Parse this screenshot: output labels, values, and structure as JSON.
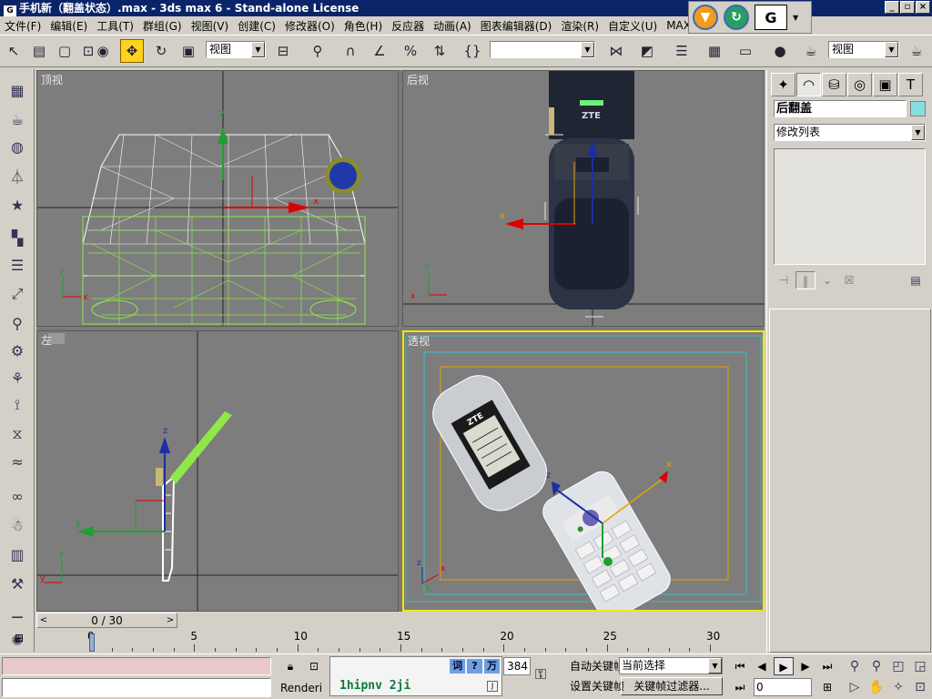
{
  "window": {
    "title": "手机新（翻盖状态）.max - 3ds max 6 - Stand-alone License",
    "icon_text": "G",
    "minimize": "_",
    "restore": "▫",
    "close": "×"
  },
  "menu": [
    "文件(F)",
    "编辑(E)",
    "工具(T)",
    "群组(G)",
    "视图(V)",
    "创建(C)",
    "修改器(O)",
    "角色(H)",
    "反应器",
    "动画(A)",
    "图表编辑器(D)",
    "渲染(R)",
    "自定义(U)",
    "MAX"
  ],
  "toolbar": {
    "view_dropdown": "视图",
    "view_dropdown_2": "视图",
    "named_selection": ""
  },
  "viewports": {
    "top": "顶视",
    "back": "后视",
    "left": "左",
    "perspective": "透视"
  },
  "right_panel": {
    "object_name": "后翻盖",
    "modifier_list": "修改列表",
    "object_color": "#88dde0"
  },
  "time_slider": {
    "frame_text": "0 / 30",
    "prev": "<",
    "next": ">"
  },
  "track_bar": {
    "labels": [
      "0",
      "5",
      "10",
      "15",
      "20",
      "25",
      "30"
    ],
    "frames": [
      0,
      5,
      10,
      15,
      20,
      25,
      30
    ]
  },
  "status": {
    "ime_candidate": "1hipnv 2ji",
    "ime_buttons": [
      "词",
      "?",
      "万"
    ],
    "rendering_text": "Renderi",
    "coord_value": "384",
    "auto_key": "自动关键帧",
    "set_key": "设置关键帧",
    "selection_set": "当前选择",
    "key_filters": "关键帧过滤器...",
    "frame_value": "0"
  },
  "colors": {
    "active_viewport_border": "#f5e600",
    "viewport_bg": "#7d7d7d",
    "title_bar": "#0a246a",
    "wire_white": "#ffffff",
    "wire_green": "#8ee84a"
  },
  "icons": {
    "select": "select-arrow-icon",
    "move": "move-icon",
    "rotate": "rotate-icon",
    "scale": "scale-icon",
    "play": "play-icon",
    "key": "key-icon",
    "zoom": "zoom-icon",
    "pan": "pan-icon",
    "orbit": "orbit-icon"
  }
}
